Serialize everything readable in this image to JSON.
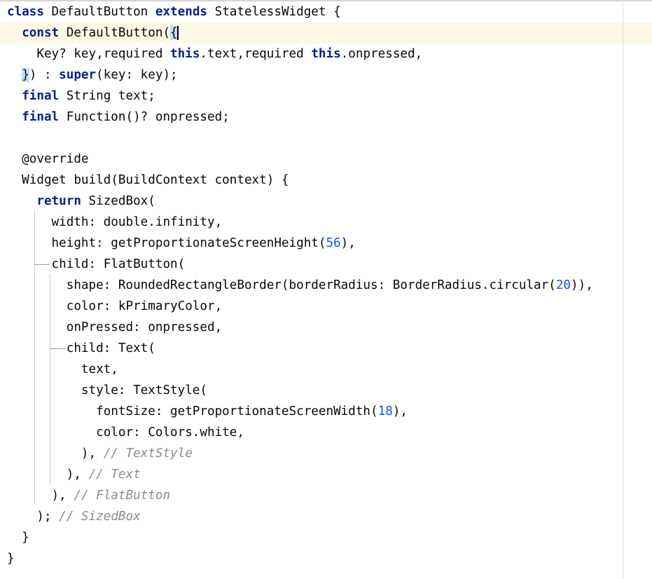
{
  "editor": {
    "language": "dart",
    "lines": [
      [
        {
          "t": "class",
          "c": "kw"
        },
        {
          "t": " DefaultButton "
        },
        {
          "t": "extends",
          "c": "kw"
        },
        {
          "t": " StatelessWidget {"
        }
      ],
      [
        {
          "t": "  "
        },
        {
          "t": "const",
          "c": "kw"
        },
        {
          "t": " DefaultButton("
        },
        {
          "t": "{",
          "c": "match"
        },
        {
          "caret": true
        }
      ],
      [
        {
          "t": "    Key? key,required "
        },
        {
          "t": "this",
          "c": "kw"
        },
        {
          "t": ".text,required "
        },
        {
          "t": "this",
          "c": "kw"
        },
        {
          "t": ".onpressed,"
        }
      ],
      [
        {
          "t": "  "
        },
        {
          "t": "}",
          "c": "match"
        },
        {
          "t": ") : "
        },
        {
          "t": "super",
          "c": "kw"
        },
        {
          "t": "(key: key);"
        }
      ],
      [
        {
          "t": "  "
        },
        {
          "t": "final",
          "c": "kw"
        },
        {
          "t": " String text;"
        }
      ],
      [
        {
          "t": "  "
        },
        {
          "t": "final",
          "c": "kw"
        },
        {
          "t": " Function()? onpressed;"
        }
      ],
      [],
      [
        {
          "t": "  @override"
        }
      ],
      [
        {
          "t": "  Widget build(BuildContext context) {"
        }
      ],
      [
        {
          "t": "    "
        },
        {
          "t": "return",
          "c": "kw"
        },
        {
          "t": " SizedBox("
        }
      ],
      [
        {
          "t": "      width: double.infinity,"
        }
      ],
      [
        {
          "t": "      height: getProportionateScreenHeight("
        },
        {
          "t": "56",
          "c": "num"
        },
        {
          "t": "),"
        }
      ],
      [
        {
          "t": "      child: FlatButton("
        }
      ],
      [
        {
          "t": "        shape: RoundedRectangleBorder(borderRadius: BorderRadius.circular("
        },
        {
          "t": "20",
          "c": "num"
        },
        {
          "t": ")),"
        }
      ],
      [
        {
          "t": "        color: kPrimaryColor,"
        }
      ],
      [
        {
          "t": "        onPressed: onpressed,"
        }
      ],
      [
        {
          "t": "        child: Text("
        }
      ],
      [
        {
          "t": "          text,"
        }
      ],
      [
        {
          "t": "          style: TextStyle("
        }
      ],
      [
        {
          "t": "            fontSize: getProportionateScreenWidth("
        },
        {
          "t": "18",
          "c": "num"
        },
        {
          "t": "),"
        }
      ],
      [
        {
          "t": "            color: Colors.white,"
        }
      ],
      [
        {
          "t": "          ), "
        },
        {
          "t": "// TextStyle",
          "c": "cmt"
        }
      ],
      [
        {
          "t": "        ), "
        },
        {
          "t": "// Text",
          "c": "cmt"
        }
      ],
      [
        {
          "t": "      ), "
        },
        {
          "t": "// FlatButton",
          "c": "cmt"
        }
      ],
      [
        {
          "t": "    ); "
        },
        {
          "t": "// SizedBox",
          "c": "cmt"
        }
      ],
      [
        {
          "t": "  }"
        }
      ],
      [
        {
          "t": "}"
        }
      ]
    ]
  }
}
